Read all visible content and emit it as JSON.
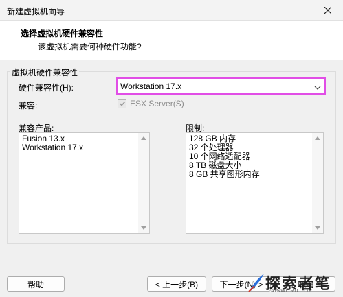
{
  "window": {
    "title": "新建虚拟机向导"
  },
  "header": {
    "title": "选择虚拟机硬件兼容性",
    "subtitle": "该虚拟机需要何种硬件功能?"
  },
  "group": {
    "legend": "虚拟机硬件兼容性"
  },
  "hardware_compat": {
    "label": "硬件兼容性(H):",
    "value": "Workstation 17.x"
  },
  "compat": {
    "label": "兼容:",
    "checkbox_label": "ESX Server(S)",
    "checked": true,
    "disabled": true
  },
  "products": {
    "label": "兼容产品:",
    "items": [
      "Fusion 13.x",
      "Workstation 17.x"
    ]
  },
  "limits": {
    "label": "限制:",
    "items": [
      "128 GB 内存",
      "32 个处理器",
      "10 个网络适配器",
      "8 TB 磁盘大小",
      "8 GB 共享图形内存"
    ]
  },
  "buttons": {
    "help": "帮助",
    "back": "< 上一步(B)",
    "next": "下一步(N) >",
    "cancel": "取消"
  },
  "watermark": {
    "text": "探索者笔",
    "sub": "AISWORD.TOP"
  },
  "colors": {
    "highlight_border": "#e14ee6",
    "background": "#f0f0f0"
  }
}
